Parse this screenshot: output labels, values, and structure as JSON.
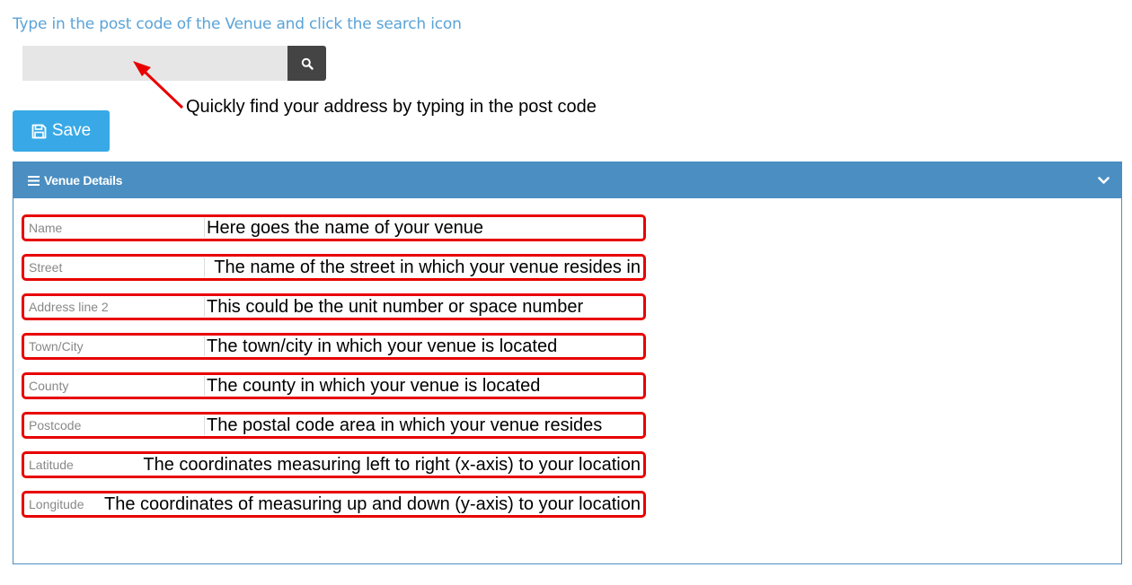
{
  "instruction": "Type in the post code of the Venue and click the search icon",
  "search": {
    "value": "",
    "placeholder": "",
    "icon": "search-icon"
  },
  "annotation": "Quickly find your address by typing in the post code",
  "save_button": {
    "label": "Save",
    "icon": "floppy-disk-icon"
  },
  "panel": {
    "title": "Venue Details",
    "icon": "bars-icon",
    "toggle_icon": "chevron-down-icon",
    "header_color": "#4a8ec2"
  },
  "fields": [
    {
      "placeholder": "Name",
      "note": "Here goes the name of your venue"
    },
    {
      "placeholder": "Street",
      "note": "The name of the street in which your venue resides in"
    },
    {
      "placeholder": "Address line 2",
      "note": "This could be the unit number or space number"
    },
    {
      "placeholder": "Town/City",
      "note": "The town/city in which your venue is located"
    },
    {
      "placeholder": "County",
      "note": "The county in which your venue is located"
    },
    {
      "placeholder": "Postcode",
      "note": "The postal code area in which your venue resides"
    },
    {
      "placeholder": "Latitude",
      "note": "The coordinates measuring left to right (x-axis) to your location"
    },
    {
      "placeholder": "Longitude",
      "note": "The coordinates of measuring up and down (y-axis) to your location"
    }
  ],
  "colors": {
    "accent": "#38a9e6",
    "highlight": "#e80000",
    "instruction": "#5aa3d8"
  }
}
